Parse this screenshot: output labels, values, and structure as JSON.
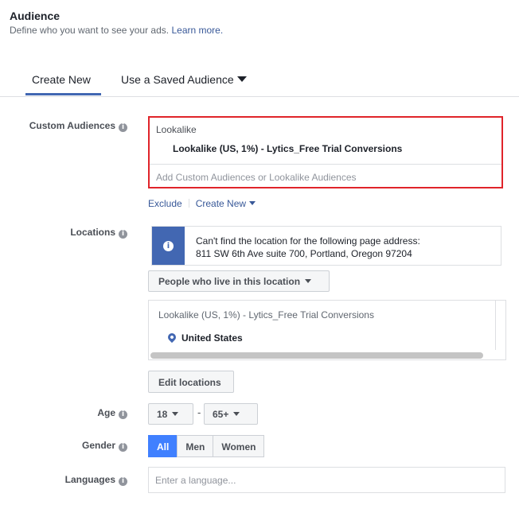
{
  "header": {
    "title": "Audience",
    "subtitle": "Define who you want to see your ads.",
    "learn_more": "Learn more."
  },
  "tabs": [
    {
      "label": "Create New",
      "active": true
    },
    {
      "label": "Use a Saved Audience",
      "active": false
    }
  ],
  "custom_audiences": {
    "label": "Custom Audiences",
    "group_label": "Lookalike",
    "selected_item": "Lookalike (US, 1%) - Lytics_Free Trial Conversions",
    "input_placeholder": "Add Custom Audiences or Lookalike Audiences",
    "exclude_label": "Exclude",
    "create_new_label": "Create New",
    "highlight_color": "#e0242a"
  },
  "locations": {
    "label": "Locations",
    "notice_line1": "Can't find the location for the following page address:",
    "notice_line2": "811 SW 6th Ave suite 700, Portland, Oregon 97204",
    "filter_label": "People who live in this location",
    "list_group": "Lookalike (US, 1%) - Lytics_Free Trial Conversions",
    "list_country": "United States",
    "edit_button": "Edit locations"
  },
  "age": {
    "label": "Age",
    "min": "18",
    "separator": "-",
    "max": "65+"
  },
  "gender": {
    "label": "Gender",
    "options": [
      "All",
      "Men",
      "Women"
    ],
    "selected": "All",
    "accent_color": "#4080ff"
  },
  "languages": {
    "label": "Languages",
    "placeholder": "Enter a language..."
  }
}
